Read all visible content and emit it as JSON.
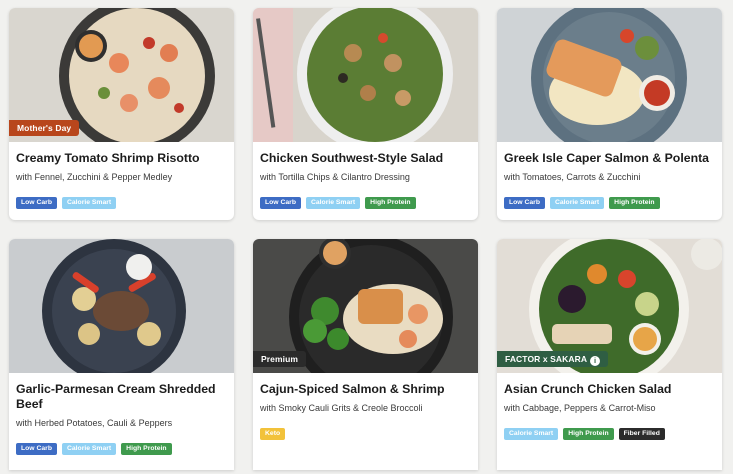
{
  "cards": [
    {
      "title": "Creamy Tomato Shrimp Risotto",
      "subtitle": "with Fennel, Zucchini & Pepper Medley",
      "flag": "Mother's Day",
      "tags": [
        "Low Carb",
        "Calorie Smart"
      ]
    },
    {
      "title": "Chicken Southwest-Style Salad",
      "subtitle": "with Tortilla Chips & Cilantro Dressing",
      "flag": "",
      "tags": [
        "Low Carb",
        "Calorie Smart",
        "High Protein"
      ]
    },
    {
      "title": "Greek Isle Caper Salmon & Polenta",
      "subtitle": "with Tomatoes, Carrots & Zucchini",
      "flag": "",
      "tags": [
        "Low Carb",
        "Calorie Smart",
        "High Protein"
      ]
    },
    {
      "title": "Garlic-Parmesan Cream Shredded Beef",
      "subtitle": "with Herbed Potatoes, Cauli & Peppers",
      "flag": "",
      "tags": [
        "Low Carb",
        "Calorie Smart",
        "High Protein"
      ]
    },
    {
      "title": "Cajun-Spiced Salmon & Shrimp",
      "subtitle": "with Smoky Cauli Grits & Creole Broccoli",
      "flag": "Premium",
      "tags": [
        "Keto"
      ]
    },
    {
      "title": "Asian Crunch Chicken Salad",
      "subtitle": "with Cabbage, Peppers & Carrot-Miso",
      "flag": "FACTOR x SAKARA",
      "tags": [
        "Calorie Smart",
        "High Protein",
        "Fiber Filled"
      ]
    }
  ],
  "colors": {
    "low_carb": "#3d6cc4",
    "calorie_smart": "#8fd0f3",
    "high_protein": "#3f9a4d",
    "keto": "#f2c23a",
    "fiber_filled": "#2b2b2b",
    "mothers_day_flag": "#b8461c",
    "premium_flag": "#2b2b2b",
    "partner_flag": "#2f5e43"
  },
  "icons": {
    "partner_flag_icon": "info-icon"
  }
}
